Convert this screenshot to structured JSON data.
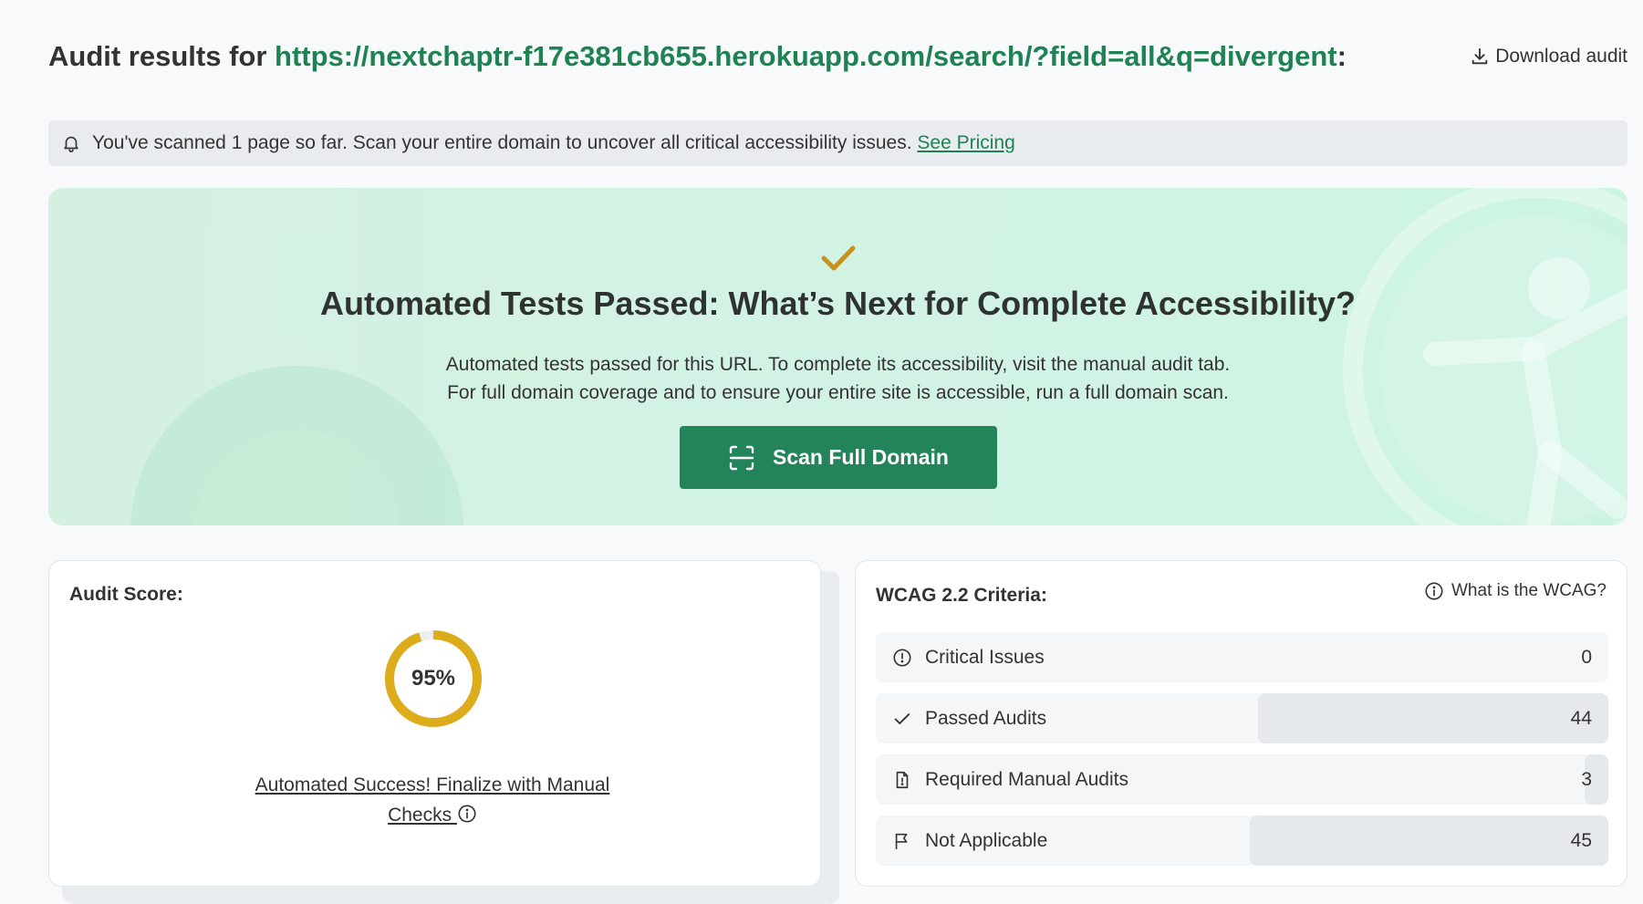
{
  "header": {
    "title_prefix": "Audit results for",
    "url": "https://nextchaptr-f17e381cb655.herokuapp.com/search/?field=all&q=divergent",
    "title_suffix": ":",
    "download_label": "Download audit",
    "download_icon": "download-icon"
  },
  "notice": {
    "icon": "bell-icon",
    "text": "You've scanned 1 page so far. Scan your entire domain to uncover all critical accessibility issues.",
    "link_label": "See Pricing"
  },
  "hero": {
    "icon": "check-icon",
    "heading": "Automated Tests Passed: What’s Next for Complete Accessibility?",
    "line1": "Automated tests passed for this URL. To complete its accessibility, visit the manual audit tab.",
    "line2": "For full domain coverage and to ensure your entire site is accessible, run a full domain scan.",
    "button_label": "Scan Full Domain",
    "button_icon": "scan-icon",
    "button_color": "#23845a"
  },
  "score": {
    "title": "Audit Score:",
    "value": "95%",
    "fraction": 0.95,
    "ring_color": "#dcac1a",
    "link_line1": "Automated Success! Finalize with Manual",
    "link_line2": "Checks "
  },
  "wcag": {
    "title": "WCAG 2.2 Criteria:",
    "help_label": "What is the WCAG?",
    "rows": [
      {
        "icon": "alert-circle-icon",
        "label": "Critical Issues",
        "count": "0",
        "fraction": 0
      },
      {
        "icon": "check-icon",
        "label": "Passed Audits",
        "count": "44",
        "fraction": 0.4783
      },
      {
        "icon": "document-icon",
        "label": "Required Manual Audits",
        "count": "3",
        "fraction": 0.0326
      },
      {
        "icon": "flag-icon",
        "label": "Not Applicable",
        "count": "45",
        "fraction": 0.4891
      }
    ]
  }
}
